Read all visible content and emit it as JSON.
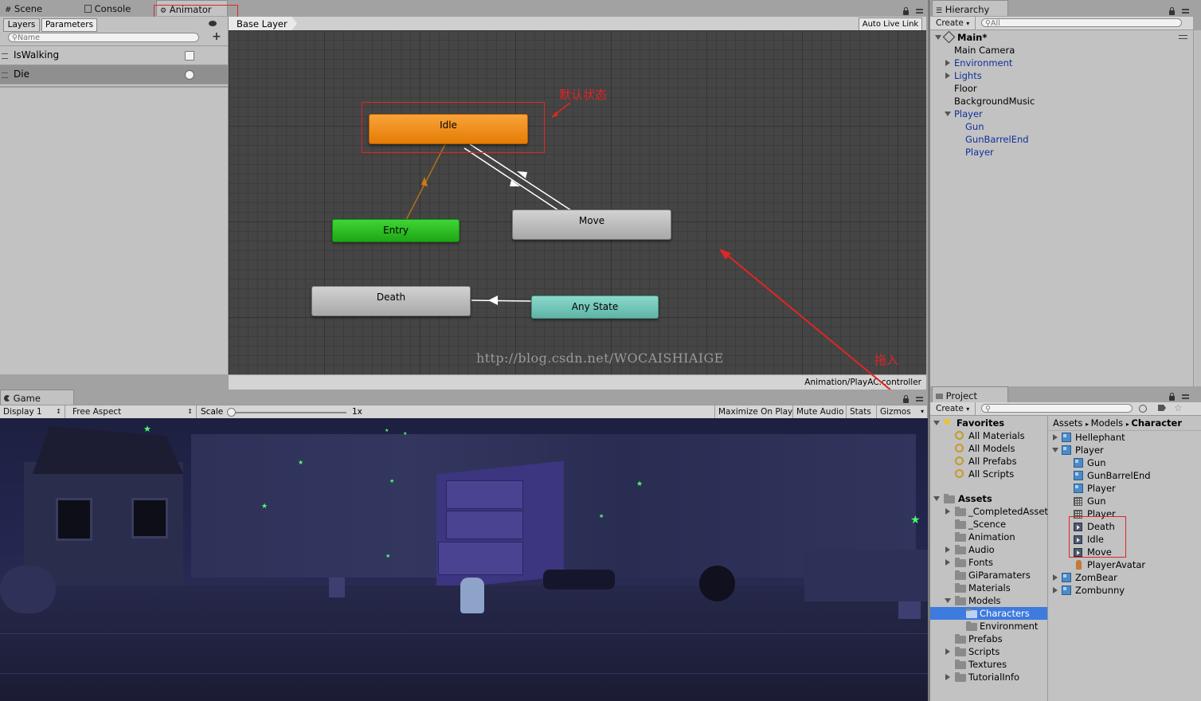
{
  "top_tabs": [
    {
      "label": "Scene",
      "icon": "scene-grid-icon"
    },
    {
      "label": "Console",
      "icon": "console-icon"
    },
    {
      "label": "Animator",
      "icon": "animator-icon"
    }
  ],
  "animator": {
    "subtabs": [
      "Layers",
      "Parameters"
    ],
    "search_placeholder": "Name",
    "params": [
      {
        "name": "IsWalking",
        "type": "bool"
      },
      {
        "name": "Die",
        "type": "trigger"
      }
    ],
    "breadcrumb": "Base Layer",
    "auto_live_link": "Auto Live Link",
    "footer_path": "Animation/PlayAC.controller",
    "nodes": {
      "idle": "Idle",
      "entry": "Entry",
      "move": "Move",
      "death": "Death",
      "any_state": "Any State"
    },
    "annotation_default": "默认状态",
    "annotation_drag": "拖入",
    "watermark": "http://blog.csdn.net/WOCAISHIAIGE"
  },
  "hierarchy": {
    "tab": "Hierarchy",
    "create": "Create",
    "search_placeholder": "All",
    "scene": "Main*",
    "items": [
      "Main Camera",
      "Environment",
      "Lights",
      "Floor",
      "BackgroundMusic",
      "Player",
      "Gun",
      "GunBarrelEnd",
      "Player"
    ]
  },
  "game": {
    "tab": "Game",
    "display": "Display 1",
    "aspect": "Free Aspect",
    "scale_label": "Scale",
    "scale_value": "1x",
    "scale_fraction": 0.0,
    "buttons": [
      "Maximize On Play",
      "Mute Audio",
      "Stats",
      "Gizmos"
    ]
  },
  "project": {
    "tab": "Project",
    "create": "Create",
    "favorites_label": "Favorites",
    "favorites": [
      "All Materials",
      "All Models",
      "All Prefabs",
      "All Scripts"
    ],
    "assets_label": "Assets",
    "folders": [
      "_CompletedAsset",
      "_Scence",
      "Animation",
      "Audio",
      "Fonts",
      "GiParamaters",
      "Materials",
      "Models",
      "Characters",
      "Environment",
      "Prefabs",
      "Scripts",
      "Textures",
      "TutorialInfo"
    ],
    "breadcrumb": [
      "Assets",
      "Models",
      "Character"
    ],
    "files": [
      "Hellephant",
      "Player",
      "Gun",
      "GunBarrelEnd",
      "Player",
      "Gun",
      "Player",
      "Death",
      "Idle",
      "Move",
      "PlayerAvatar",
      "ZomBear",
      "Zombunny"
    ]
  },
  "colors": {
    "idle_node": "#f08a0c",
    "entry_node": "#27b81f",
    "any_state_node": "#6fc4b4",
    "default_node": "#b8b8b8",
    "annotation_red": "#e32424",
    "selection_blue": "#3d7bde"
  }
}
